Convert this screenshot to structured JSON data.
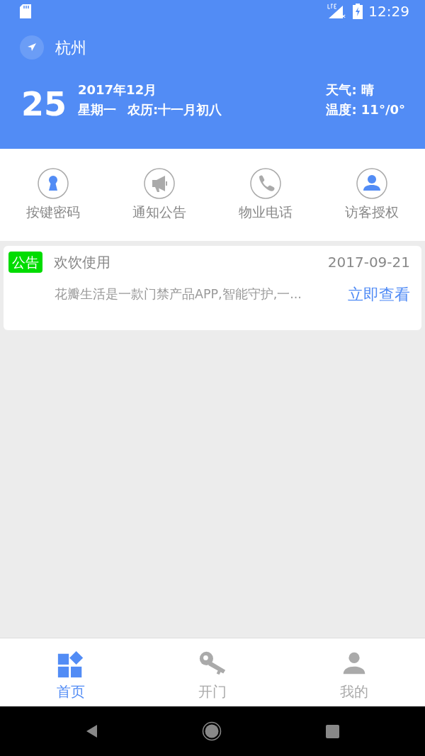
{
  "status_bar": {
    "time": "12:29"
  },
  "header": {
    "city": "杭州",
    "day": "25",
    "month": "2017年12月",
    "weekday": "星期一",
    "lunar": "农历:十一月初八",
    "weather": "天气: 晴",
    "temperature": "温度: 11°/0°"
  },
  "quick_actions": [
    {
      "kind": "keyhole",
      "label": "按键密码"
    },
    {
      "kind": "megaphone",
      "label": "通知公告"
    },
    {
      "kind": "phone",
      "label": "物业电话"
    },
    {
      "kind": "person",
      "label": "访客授权"
    }
  ],
  "notices": [
    {
      "tag": "公告",
      "title": "欢饮使用",
      "date": "2017-09-21",
      "summary": "花瓣生活是一款门禁产品APP,智能守护,一...",
      "link": "立即查看"
    }
  ],
  "bottom_tabs": [
    {
      "kind": "home",
      "label": "首页",
      "selected": true
    },
    {
      "kind": "key",
      "label": "开门",
      "selected": false
    },
    {
      "kind": "profile",
      "label": "我的",
      "selected": false
    }
  ]
}
